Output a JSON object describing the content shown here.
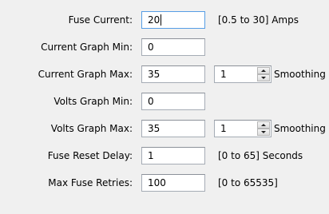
{
  "rows": [
    {
      "label": "Fuse Current:",
      "value": "20",
      "hint": "[0.5 to 30] Amps"
    },
    {
      "label": "Current Graph Min:",
      "value": "0"
    },
    {
      "label": "Current Graph Max:",
      "value": "35",
      "spin_value": "1",
      "spin_label": "Smoothing"
    },
    {
      "label": "Volts Graph Min:",
      "value": "0"
    },
    {
      "label": "Volts Graph Max:",
      "value": "35",
      "spin_value": "1",
      "spin_label": "Smoothing"
    },
    {
      "label": "Fuse Reset Delay:",
      "value": "1",
      "hint": "[0 to 65] Seconds"
    },
    {
      "label": "Max Fuse Retries:",
      "value": "100",
      "hint": "[0 to 65535]"
    }
  ],
  "icons": {
    "spin_up": "triangle-up-icon",
    "spin_down": "triangle-down-icon"
  }
}
